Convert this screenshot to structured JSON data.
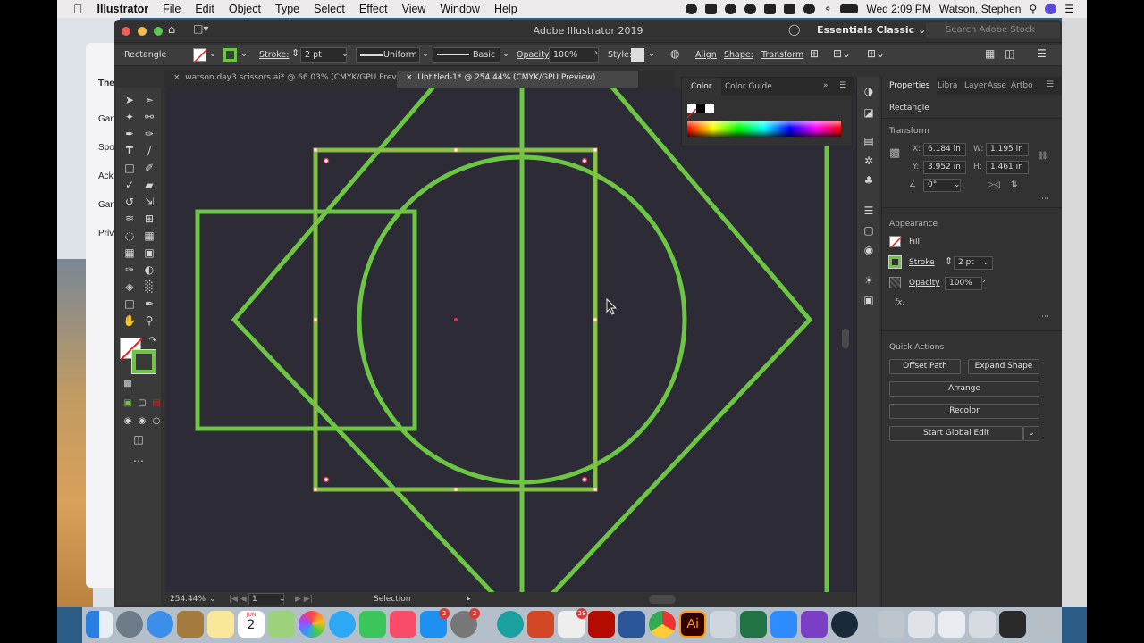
{
  "menubar": {
    "app_name": "Illustrator",
    "items": [
      "File",
      "Edit",
      "Object",
      "Type",
      "Select",
      "Effect",
      "View",
      "Window",
      "Help"
    ],
    "clock": "Wed 2:09 PM",
    "user": "Watson, Stephen"
  },
  "background_window": {
    "items": [
      "The",
      "Gan",
      "Spo",
      "Ack",
      "Gan",
      "Priv"
    ]
  },
  "app": {
    "title": "Adobe Illustrator 2019",
    "workspace": "Essentials Classic",
    "search_placeholder": "Search Adobe Stock"
  },
  "control_bar": {
    "selection_type": "Rectangle",
    "stroke_label": "Stroke:",
    "stroke_weight": "2 pt",
    "profile": "Uniform",
    "brush": "Basic",
    "opacity_label": "Opacity:",
    "opacity": "100%",
    "style_label": "Style:",
    "align": "Align",
    "shape": "Shape:",
    "transform": "Transform"
  },
  "tabs": [
    {
      "label": "watson.day3.scissors.ai* @ 66.03% (CMYK/GPU Preview)",
      "active": false
    },
    {
      "label": "Untitled-1* @ 254.44% (CMYK/GPU Preview)",
      "active": true
    }
  ],
  "status_bar": {
    "zoom": "254.44%",
    "artboard": "1",
    "tool": "Selection"
  },
  "color_panel": {
    "tab_color": "Color",
    "tab_guide": "Color Guide"
  },
  "properties": {
    "tabs": [
      "Properties",
      "Libra",
      "Layer",
      "Asse",
      "Artbo"
    ],
    "object_type": "Rectangle",
    "transform_heading": "Transform",
    "x_label": "X:",
    "x": "6.184 in",
    "y_label": "Y:",
    "y": "3.952 in",
    "w_label": "W:",
    "w": "1.195 in",
    "h_label": "H:",
    "h": "1.461 in",
    "angle": "0°",
    "appearance_heading": "Appearance",
    "fill_label": "Fill",
    "stroke_label": "Stroke",
    "stroke_value": "2 pt",
    "opacity_label": "Opacity",
    "opacity_value": "100%",
    "fx": "fx.",
    "quick_actions_heading": "Quick Actions",
    "buttons": {
      "offset_path": "Offset Path",
      "expand_shape": "Expand Shape",
      "arrange": "Arrange",
      "recolor": "Recolor",
      "global_edit": "Start Global Edit"
    }
  },
  "dock": {
    "calendar_month": "JUN",
    "calendar_day": "2",
    "badge_appstore": "2",
    "badge_prefs": "2",
    "badge_ppt": "28"
  },
  "colors": {
    "stroke_green": "#6cc644",
    "canvas": "#2d2b36",
    "selection": "#d4a84e"
  }
}
